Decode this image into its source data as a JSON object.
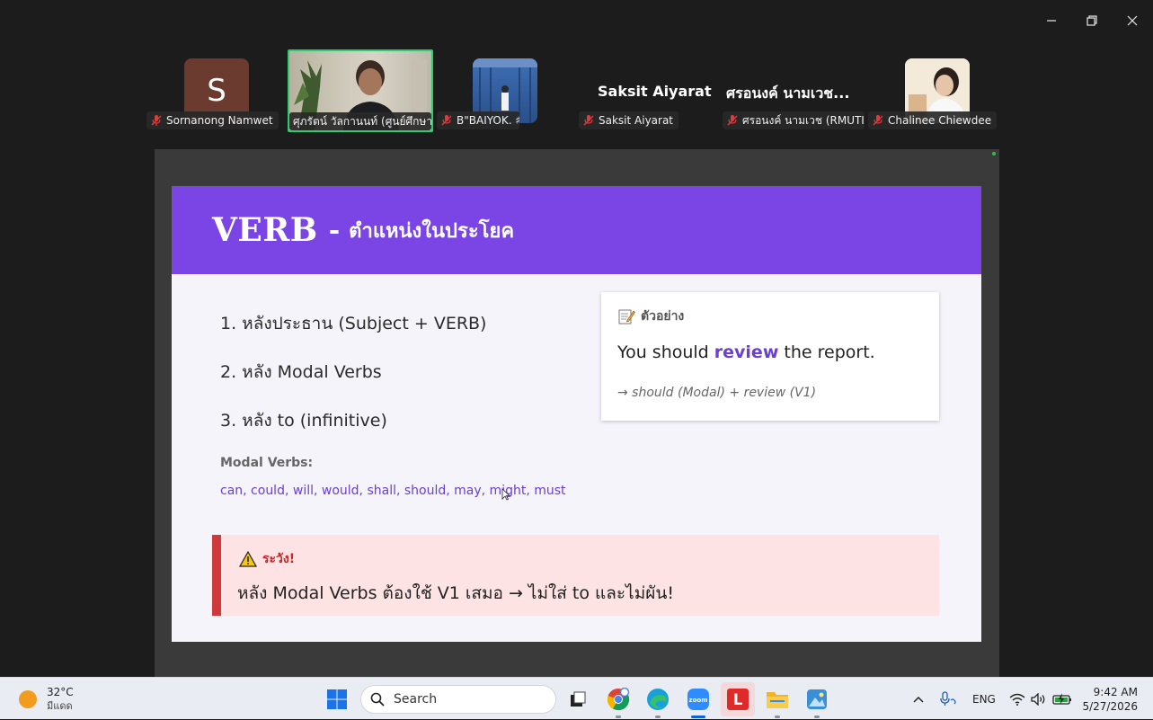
{
  "participants": [
    {
      "name": "Sornanong Namwet",
      "initial": "S",
      "avatar_color": "#6a3b2e"
    },
    {
      "name": "ศุภรัตน์ วัลกานนท์ (ศูนย์ศึกษา...",
      "active_speaker": true
    },
    {
      "name": "B\"BAIYOK. ♯"
    },
    {
      "name": "Saksit Aiyarat",
      "display_label": "Saksit Aiyarat"
    },
    {
      "name": "ศรอนงค์ นามเวช (RMUTI ...",
      "display_label": "ศรอนงค์ นามเวช..."
    },
    {
      "name": "Chalinee Chiewdee"
    }
  ],
  "slide": {
    "title_main": "VERB",
    "title_dash": "-",
    "title_sub": "ตำแหน่งในประโยค",
    "points": [
      "1. หลังประธาน (Subject + VERB)",
      "2. หลัง Modal Verbs",
      "3. หลัง to (infinitive)"
    ],
    "modal_label": "Modal Verbs:",
    "modal_list": "can, could, will, would, shall, should, may, might, must",
    "example": {
      "icon": "memo-icon",
      "title": "ตัวอย่าง",
      "sentence_before": "You should ",
      "sentence_highlight": "review",
      "sentence_after": " the report.",
      "note": "→ should (Modal) + review (V1)"
    },
    "warning": {
      "icon": "warning-icon",
      "title": "ระวัง!",
      "text": "หลัง Modal Verbs ต้องใช้ V1 เสมอ → ไม่ใส่ to และไม่ผัน!"
    }
  },
  "colors": {
    "accent_purple": "#7b45e6",
    "active_speaker_border": "#2ecc71",
    "warning_red": "#d0393a"
  },
  "taskbar": {
    "weather_temp": "32°C",
    "weather_desc": "มีแดด",
    "search_placeholder": "Search",
    "language": "ENG",
    "time": "9:42 AM",
    "date": "5/27/2026",
    "apps": [
      "task-view",
      "chrome",
      "edge",
      "zoom",
      "l-app",
      "file-explorer",
      "photos"
    ]
  }
}
